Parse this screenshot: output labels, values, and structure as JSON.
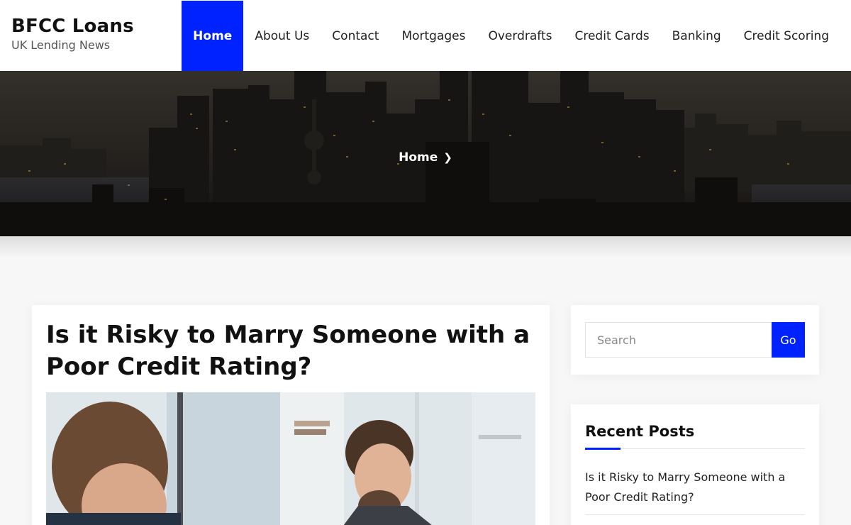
{
  "site": {
    "title": "BFCC Loans",
    "tagline": "UK Lending News"
  },
  "nav": {
    "items": [
      {
        "label": "Home",
        "active": true
      },
      {
        "label": "About Us"
      },
      {
        "label": "Contact"
      },
      {
        "label": "Mortgages"
      },
      {
        "label": "Overdrafts"
      },
      {
        "label": "Credit Cards"
      },
      {
        "label": "Banking"
      },
      {
        "label": "Credit Scoring"
      }
    ],
    "accent_color": "#0022ff"
  },
  "hero": {
    "breadcrumb": "Home",
    "breadcrumb_icon": "chevron-right-icon"
  },
  "article": {
    "title": "Is it Risky to Marry Someone with a Poor Credit Rating?"
  },
  "sidebar": {
    "search": {
      "placeholder": "Search",
      "value": "",
      "button_label": "Go"
    },
    "recent_posts": {
      "title": "Recent Posts",
      "items": [
        "Is it Risky to Marry Someone with a Poor Credit Rating?"
      ]
    }
  }
}
